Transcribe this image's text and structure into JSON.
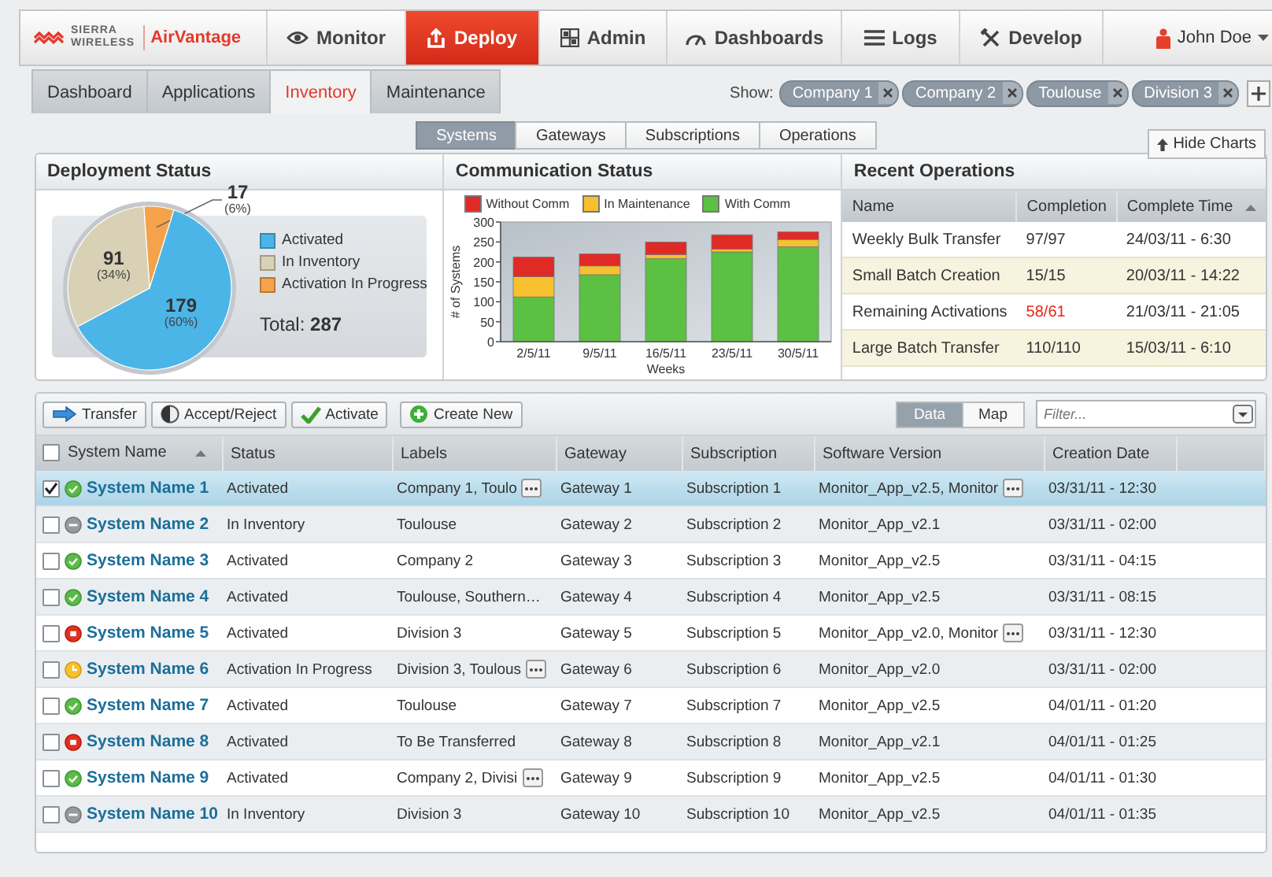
{
  "header": {
    "brand": [
      "SIERRA",
      "WIRELESS"
    ],
    "product": "AirVantage",
    "nav": [
      {
        "label": "Monitor",
        "kind": "eye",
        "selected": false
      },
      {
        "label": "Deploy",
        "kind": "upload",
        "selected": true
      },
      {
        "label": "Admin",
        "kind": "grid",
        "selected": false
      },
      {
        "label": "Dashboards",
        "kind": "gauge",
        "selected": false
      },
      {
        "label": "Logs",
        "kind": "list",
        "selected": false
      },
      {
        "label": "Develop",
        "kind": "tools",
        "selected": false
      }
    ],
    "user": "John Doe"
  },
  "subnav": {
    "tabs": [
      {
        "label": "Dashboard",
        "selected": false
      },
      {
        "label": "Applications",
        "selected": false
      },
      {
        "label": "Inventory",
        "selected": true
      },
      {
        "label": "Maintenance",
        "selected": false
      }
    ],
    "show_label": "Show:",
    "filters": [
      "Company 1",
      "Company 2",
      "Toulouse",
      "Division 3"
    ]
  },
  "views": [
    {
      "label": "Systems",
      "selected": true
    },
    {
      "label": "Gateways",
      "selected": false
    },
    {
      "label": "Subscriptions",
      "selected": false
    },
    {
      "label": "Operations",
      "selected": false
    }
  ],
  "hide_charts": "Hide Charts",
  "deployment": {
    "title": "Deployment Status",
    "total": "Total: **287**",
    "chart_data": {
      "type": "pie",
      "legend": "right",
      "categories": [
        "Activated",
        "In Inventory",
        "Activation In Progress"
      ],
      "values": [
        179,
        91,
        17
      ],
      "colors": [
        "#4cb5e8",
        "#d9d1b6",
        "#f5a24a"
      ],
      "value_labels": [
        "179 $_{(60%)}$",
        "91 $_{(34%)}$",
        "17 $_{(6%)}$"
      ]
    }
  },
  "communication": {
    "title": "Communication Status",
    "chart_data": {
      "type": "bar",
      "stacked": true,
      "legend": "top",
      "xlabel": "Weeks",
      "ylabel": "# of Systems",
      "categories": [
        "2/5/11",
        "9/5/11",
        "16/5/11",
        "23/5/11",
        "30/5/11"
      ],
      "ylim": [
        0,
        300
      ],
      "yticks": [
        0,
        50,
        100,
        150,
        200,
        250,
        300
      ],
      "series": [
        {
          "name": "Without Comm",
          "color": "#e02a26",
          "values": [
            49,
            30,
            32,
            36,
            19
          ]
        },
        {
          "name": "In Maintenance",
          "color": "#f6c02e",
          "values": [
            51,
            22,
            10,
            7,
            18
          ]
        },
        {
          "name": "With Comm",
          "color": "#5cc043",
          "values": [
            112,
            168,
            208,
            225,
            238
          ]
        }
      ]
    }
  },
  "recent": {
    "title": "Recent Operations",
    "columns": [
      {
        "label": "Name",
        "sorted": false
      },
      {
        "label": "Completion",
        "sorted": false
      },
      {
        "label": "Complete Time",
        "sorted": true
      }
    ],
    "rows": [
      {
        "name": "Weekly Bulk Transfer",
        "completion": "97/97",
        "warning": false,
        "time": "24/03/11 - 6:30"
      },
      {
        "name": "Small Batch Creation",
        "completion": "15/15",
        "warning": false,
        "time": "20/03/11 - 14:22"
      },
      {
        "name": "Remaining Activations",
        "completion": "58/61",
        "warning": true,
        "time": "21/03/11 - 21:05"
      },
      {
        "name": "Large Batch Transfer",
        "completion": "110/110",
        "warning": false,
        "time": "15/03/11 - 6:10"
      }
    ]
  },
  "systems": {
    "actions": [
      {
        "label": "Transfer",
        "kind": "arrow"
      },
      {
        "label": "Accept/Reject",
        "kind": "half"
      },
      {
        "label": "Activate",
        "kind": "check"
      },
      {
        "label": "Create New",
        "kind": "plus"
      }
    ],
    "view_modes": [
      {
        "label": "Data",
        "selected": true
      },
      {
        "label": "Map",
        "selected": false
      }
    ],
    "filter": {
      "placeholder": "Filter..."
    },
    "all_checked": false,
    "columns": [
      {
        "label": "System Name",
        "sorted": true
      },
      {
        "label": "Status",
        "sorted": false
      },
      {
        "label": "Labels",
        "sorted": false
      },
      {
        "label": "Gateway",
        "sorted": false
      },
      {
        "label": "Subscription",
        "sorted": false
      },
      {
        "label": "Software Version",
        "sorted": false
      },
      {
        "label": "Creation Date",
        "sorted": false
      }
    ],
    "rows": [
      {
        "checked": true,
        "selected": true,
        "kind": "ok",
        "name": "System Name 1",
        "status": "Activated",
        "labels": "Company 1, Toulo",
        "labels_more": true,
        "gateway": "Gateway 1",
        "subscription": "Subscription 1",
        "software": "Monitor_App_v2.5, Monitor",
        "software_more": true,
        "created": "03/31/11 - 12:30"
      },
      {
        "checked": false,
        "selected": false,
        "kind": "inactive",
        "name": "System Name 2",
        "status": "In Inventory",
        "labels": "Toulouse",
        "labels_more": false,
        "gateway": "Gateway 2",
        "subscription": "Subscription 2",
        "software": "Monitor_App_v2.1",
        "software_more": false,
        "created": "03/31/11 - 02:00"
      },
      {
        "checked": false,
        "selected": false,
        "kind": "ok",
        "name": "System Name 3",
        "status": "Activated",
        "labels": "Company 2",
        "labels_more": false,
        "gateway": "Gateway 3",
        "subscription": "Subscription 3",
        "software": "Monitor_App_v2.5",
        "software_more": false,
        "created": "03/31/11 - 04:15"
      },
      {
        "checked": false,
        "selected": false,
        "kind": "ok",
        "name": "System Name 4",
        "status": "Activated",
        "labels": "Toulouse, Southern…",
        "labels_more": false,
        "gateway": "Gateway 4",
        "subscription": "Subscription 4",
        "software": "Monitor_App_v2.5",
        "software_more": false,
        "created": "03/31/11 - 08:15"
      },
      {
        "checked": false,
        "selected": false,
        "kind": "error",
        "name": "System Name 5",
        "status": "Activated",
        "labels": "Division 3",
        "labels_more": false,
        "gateway": "Gateway 5",
        "subscription": "Subscription 5",
        "software": "Monitor_App_v2.0, Monitor",
        "software_more": true,
        "created": "03/31/11 - 12:30"
      },
      {
        "checked": false,
        "selected": false,
        "kind": "pending",
        "name": "System Name 6",
        "status": "Activation In Progress",
        "labels": "Division 3, Toulous",
        "labels_more": true,
        "gateway": "Gateway 6",
        "subscription": "Subscription 6",
        "software": "Monitor_App_v2.0",
        "software_more": false,
        "created": "03/31/11 - 02:00"
      },
      {
        "checked": false,
        "selected": false,
        "kind": "ok",
        "name": "System Name 7",
        "status": "Activated",
        "labels": "Toulouse",
        "labels_more": false,
        "gateway": "Gateway 7",
        "subscription": "Subscription 7",
        "software": "Monitor_App_v2.5",
        "software_more": false,
        "created": "04/01/11 - 01:20"
      },
      {
        "checked": false,
        "selected": false,
        "kind": "error",
        "name": "System Name 8",
        "status": "Activated",
        "labels": "To Be Transferred",
        "labels_more": false,
        "gateway": "Gateway 8",
        "subscription": "Subscription 8",
        "software": "Monitor_App_v2.1",
        "software_more": false,
        "created": "04/01/11 - 01:25"
      },
      {
        "checked": false,
        "selected": false,
        "kind": "ok",
        "name": "System Name 9",
        "status": "Activated",
        "labels": "Company 2, Divisi",
        "labels_more": true,
        "gateway": "Gateway 9",
        "subscription": "Subscription 9",
        "software": "Monitor_App_v2.5",
        "software_more": false,
        "created": "04/01/11 - 01:30"
      },
      {
        "checked": false,
        "selected": false,
        "kind": "inactive",
        "name": "System Name 10",
        "status": "In Inventory",
        "labels": "Division 3",
        "labels_more": false,
        "gateway": "Gateway 10",
        "subscription": "Subscription 10",
        "software": "Monitor_App_v2.5",
        "software_more": false,
        "created": "04/01/11 - 01:35"
      }
    ]
  }
}
